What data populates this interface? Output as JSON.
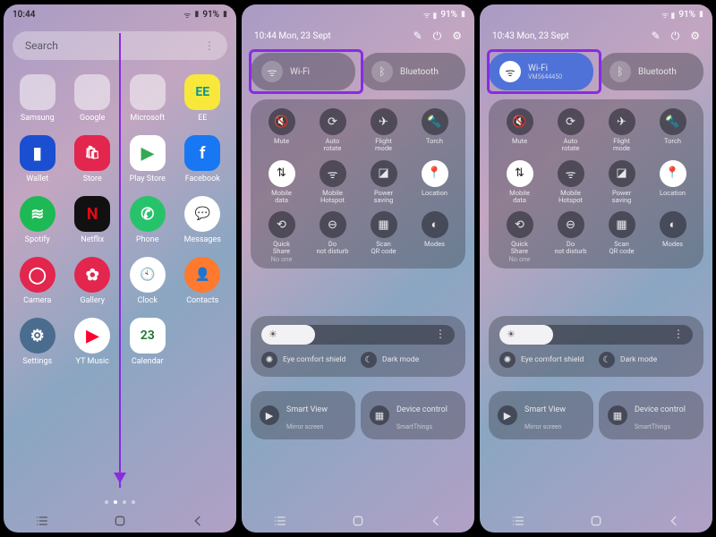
{
  "home": {
    "status": {
      "time": "10:44",
      "battery": "91%"
    },
    "search_placeholder": "Search",
    "apps": [
      {
        "label": "Samsung",
        "type": "folder",
        "c": [
          "#2f6fd0",
          "#ff6a2b",
          "#2f6fd0",
          "#2f6fd0"
        ]
      },
      {
        "label": "Google",
        "type": "folder",
        "c": [
          "#ffffff",
          "#ea4335",
          "#34a853",
          "#4285f4"
        ]
      },
      {
        "label": "Microsoft",
        "type": "folder",
        "c": [
          "#0078d4",
          "#107c10",
          "#5059c9",
          "#d83b01"
        ]
      },
      {
        "label": "EE",
        "bg": "#f7e83b",
        "glyph": "EE",
        "fg": "#0a9396"
      },
      {
        "label": "Wallet",
        "bg": "#1a4fd1",
        "glyph": "▮",
        "fg": "#fff"
      },
      {
        "label": "Store",
        "bg": "#e2264d",
        "glyph": "🛍",
        "fg": "#fff"
      },
      {
        "label": "Play Store",
        "bg": "#ffffff",
        "glyph": "▶",
        "fg": "#34a853"
      },
      {
        "label": "Facebook",
        "bg": "#1877f2",
        "glyph": "f",
        "fg": "#fff"
      },
      {
        "label": "Spotify",
        "bg": "#1db954",
        "glyph": "≋",
        "fg": "#fff",
        "round": true
      },
      {
        "label": "Netflix",
        "bg": "#111",
        "glyph": "N",
        "fg": "#e50914"
      },
      {
        "label": "Phone",
        "bg": "#27c36a",
        "glyph": "✆",
        "fg": "#fff",
        "round": true
      },
      {
        "label": "Messages",
        "bg": "#ffffff",
        "glyph": "💬",
        "fg": "#2b6fe3",
        "round": true
      },
      {
        "label": "Camera",
        "bg": "#e2264d",
        "glyph": "◯",
        "fg": "#fff",
        "round": true
      },
      {
        "label": "Gallery",
        "bg": "#e2264d",
        "glyph": "✿",
        "fg": "#fff",
        "round": true
      },
      {
        "label": "Clock",
        "bg": "#ffffff",
        "glyph": "🕙",
        "fg": "#3a3a3a",
        "round": true
      },
      {
        "label": "Contacts",
        "bg": "#ff7a2f",
        "glyph": "👤",
        "fg": "#fff",
        "round": true
      },
      {
        "label": "Settings",
        "bg": "#4a6c8f",
        "glyph": "⚙",
        "fg": "#fff",
        "round": true
      },
      {
        "label": "YT Music",
        "bg": "#ffffff",
        "glyph": "▶",
        "fg": "#ff0033",
        "round": true
      },
      {
        "label": "Calendar",
        "bg": "#ffffff",
        "glyph": "23",
        "fg": "#2a7a3a"
      }
    ]
  },
  "panel_off": {
    "status": {
      "battery": "91%"
    },
    "datetime": "10:44  Mon, 23 Sept",
    "wifi": {
      "label": "Wi-Fi",
      "sub": "",
      "on": false
    },
    "bt": {
      "label": "Bluetooth",
      "on": false
    }
  },
  "panel_on": {
    "status": {
      "battery": "91%"
    },
    "datetime": "10:43  Mon, 23 Sept",
    "wifi": {
      "label": "Wi-Fi",
      "sub": "VM5644450",
      "on": true
    },
    "bt": {
      "label": "Bluetooth",
      "on": false
    }
  },
  "quick_tiles": [
    {
      "label": "Mute",
      "icon": "🔇"
    },
    {
      "label": "Auto rotate",
      "icon": "⟳"
    },
    {
      "label": "Flight mode",
      "icon": "✈"
    },
    {
      "label": "Torch",
      "icon": "🔦"
    },
    {
      "label": "Mobile data",
      "icon": "⇅",
      "on": true
    },
    {
      "label": "Mobile Hotspot",
      "icon": "ᯤ"
    },
    {
      "label": "Power saving",
      "icon": "◪"
    },
    {
      "label": "Location",
      "icon": "📍",
      "on": true
    },
    {
      "label": "Quick Share",
      "sub": "No one",
      "icon": "⟲"
    },
    {
      "label": "Do not disturb",
      "icon": "⊖"
    },
    {
      "label": "Scan QR code",
      "icon": "▦"
    },
    {
      "label": "Modes",
      "icon": "◐"
    }
  ],
  "brightness": {
    "eye": "Eye comfort shield",
    "dark": "Dark mode"
  },
  "cards": {
    "smartview": {
      "title": "Smart View",
      "sub": "Mirror screen"
    },
    "device": {
      "title": "Device control",
      "sub": "SmartThings"
    }
  }
}
